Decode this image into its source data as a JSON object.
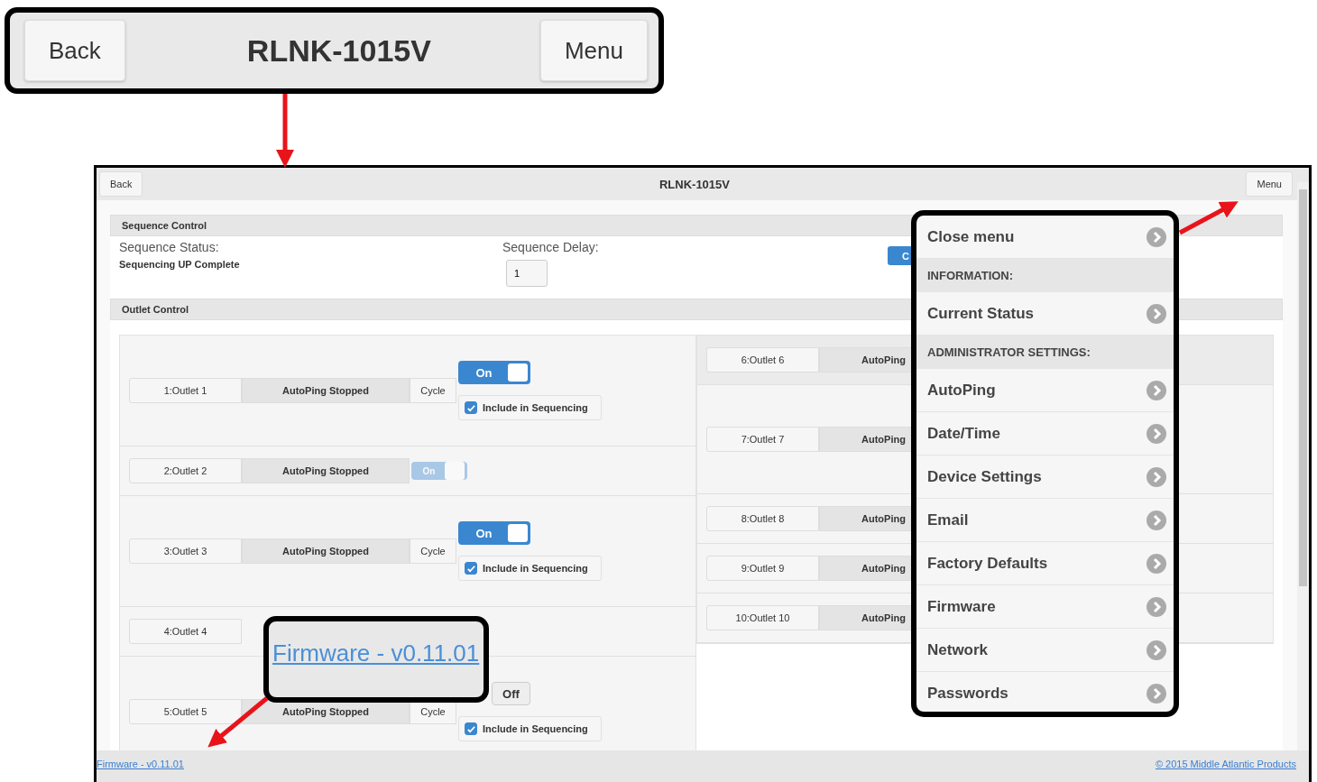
{
  "header_callout": {
    "back": "Back",
    "title": "RLNK-1015V",
    "menu": "Menu"
  },
  "header": {
    "back": "Back",
    "title": "RLNK-1015V",
    "menu": "Menu"
  },
  "sequence_control": {
    "title": "Sequence Control",
    "status_label": "Sequence Status:",
    "status": "Sequencing UP Complete",
    "delay_label": "Sequence Delay:",
    "delay_value": "1",
    "button": "C"
  },
  "outlet_control": {
    "title": "Outlet Control",
    "left": [
      {
        "name": "1:Outlet 1",
        "autoping": "AutoPing Stopped",
        "cycle": "Cycle",
        "toggle": {
          "label": "On",
          "on": true,
          "disabled": false
        },
        "include": {
          "label": "Include in Sequencing",
          "checked": true
        }
      },
      {
        "name": "2:Outlet 2",
        "autoping": "AutoPing Stopped",
        "toggle": {
          "label": "On",
          "on": true,
          "disabled": true
        }
      },
      {
        "name": "3:Outlet 3",
        "autoping": "AutoPing Stopped",
        "cycle": "Cycle",
        "toggle": {
          "label": "On",
          "on": true,
          "disabled": false
        },
        "include": {
          "label": "Include in Sequencing",
          "checked": true
        }
      },
      {
        "name": "4:Outlet 4"
      },
      {
        "name": "5:Outlet 5",
        "autoping": "AutoPing Stopped",
        "cycle": "Cycle",
        "toggle": {
          "label": "Off",
          "on": false,
          "disabled": false
        },
        "include": {
          "label": "Include in Sequencing",
          "checked": true
        }
      }
    ],
    "right": [
      {
        "name": "6:Outlet 6",
        "autoping": "AutoPing"
      },
      {
        "name": "7:Outlet 7",
        "autoping": "AutoPing"
      },
      {
        "name": "8:Outlet 8",
        "autoping": "AutoPing"
      },
      {
        "name": "9:Outlet 9",
        "autoping": "AutoPing"
      },
      {
        "name": "10:Outlet 10",
        "autoping": "AutoPing"
      }
    ]
  },
  "menu": [
    {
      "kind": "item",
      "label": "Close menu"
    },
    {
      "kind": "heading",
      "label": "INFORMATION:"
    },
    {
      "kind": "item",
      "label": "Current Status"
    },
    {
      "kind": "heading",
      "label": "ADMINISTRATOR SETTINGS:"
    },
    {
      "kind": "item",
      "label": "AutoPing"
    },
    {
      "kind": "item",
      "label": "Date/Time"
    },
    {
      "kind": "item",
      "label": "Device Settings"
    },
    {
      "kind": "item",
      "label": "Email"
    },
    {
      "kind": "item",
      "label": "Factory Defaults"
    },
    {
      "kind": "item",
      "label": "Firmware"
    },
    {
      "kind": "item",
      "label": "Network"
    },
    {
      "kind": "item",
      "label": "Passwords"
    }
  ],
  "firmware_callout": "Firmware - v0.11.01",
  "footer": {
    "firmware": "Firmware - v0.11.01",
    "copyright": "© 2015 Middle Atlantic Products"
  }
}
